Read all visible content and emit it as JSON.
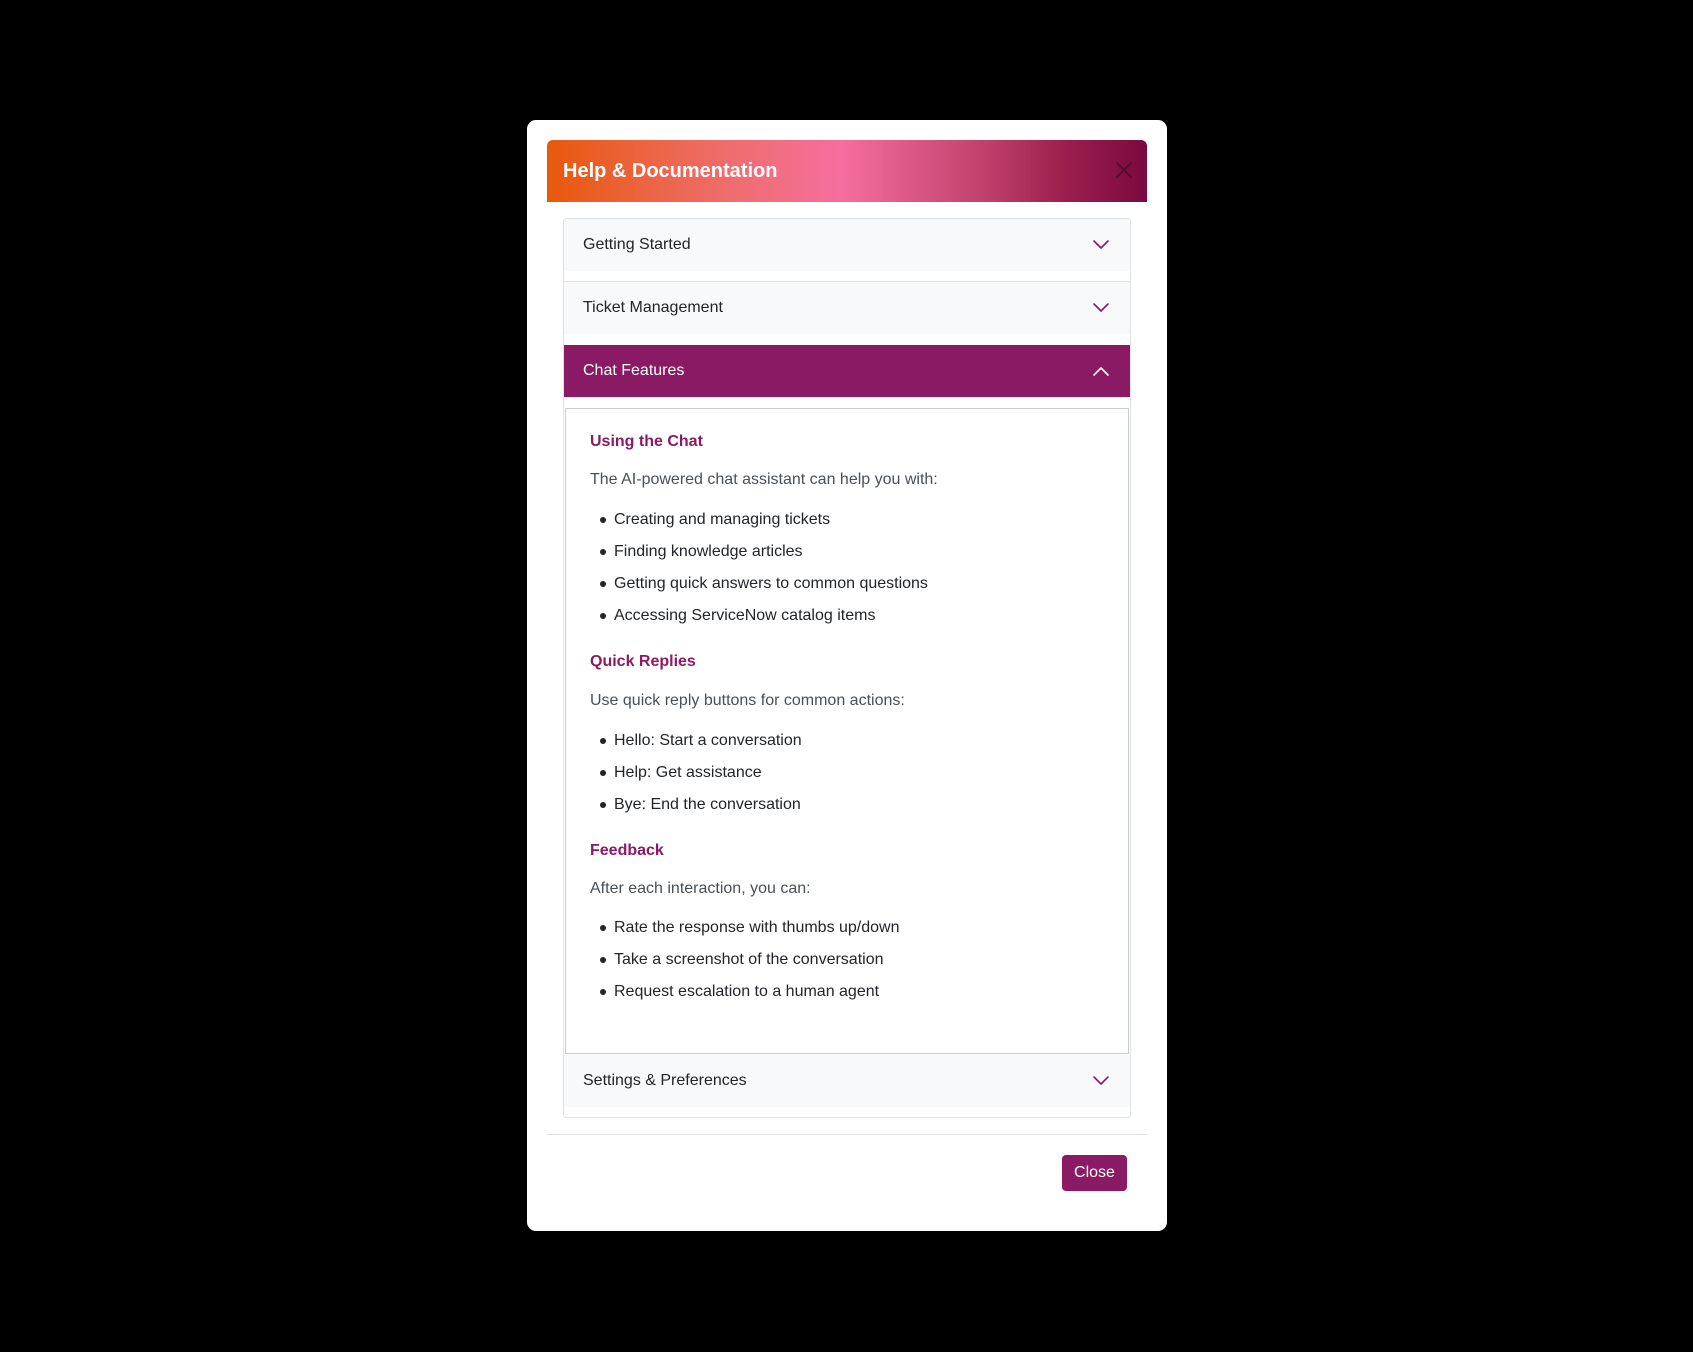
{
  "modal": {
    "title": "Help & Documentation",
    "close_icon": "close-icon",
    "close_button_label": "Close"
  },
  "accordion": {
    "items": [
      {
        "label": "Getting Started",
        "expanded": false,
        "icon": "chevron-down-icon"
      },
      {
        "label": "Ticket Management",
        "expanded": false,
        "icon": "chevron-down-icon"
      },
      {
        "label": "Chat Features",
        "expanded": true,
        "icon": "chevron-up-icon"
      },
      {
        "label": "Settings & Preferences",
        "expanded": false,
        "icon": "chevron-down-icon"
      }
    ]
  },
  "chat_features": {
    "sections": [
      {
        "title": "Using the Chat",
        "intro": "The AI-powered chat assistant can help you with:",
        "items": [
          "Creating and managing tickets",
          "Finding knowledge articles",
          "Getting quick answers to common questions",
          "Accessing ServiceNow catalog items"
        ]
      },
      {
        "title": "Quick Replies",
        "intro": "Use quick reply buttons for common actions:",
        "items": [
          "Hello: Start a conversation",
          "Help: Get assistance",
          "Bye: End the conversation"
        ]
      },
      {
        "title": "Feedback",
        "intro": "After each interaction, you can:",
        "items": [
          "Rate the response with thumbs up/down",
          "Take a screenshot of the conversation",
          "Request escalation to a human agent"
        ]
      }
    ]
  },
  "colors": {
    "accent": "#8b1a64",
    "header_gradient_start": "#e8590c",
    "header_gradient_mid": "#f56e9e",
    "header_gradient_end": "#7a0a3e",
    "backdrop": "#000000"
  }
}
